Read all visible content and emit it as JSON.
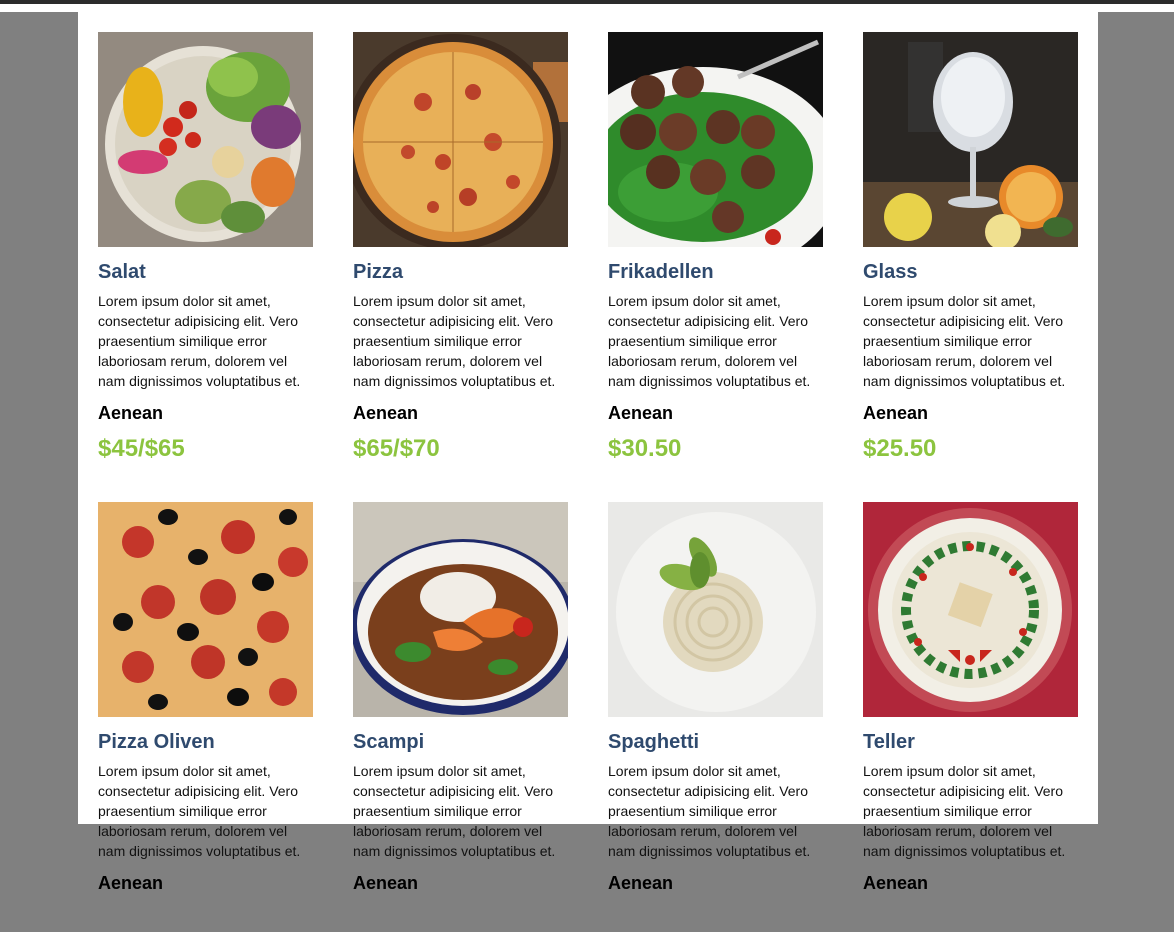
{
  "colors": {
    "title": "#2f4a6e",
    "price": "#8cc43f",
    "backdrop": "#808080",
    "panel": "#ffffff"
  },
  "items": [
    {
      "name": "Salat",
      "description": "Lorem ipsum dolor sit amet, consectetur adipisicing elit. Vero praesentium similique error laboriosam rerum, dolorem vel nam dignissimos voluptatibus et.",
      "subtitle": "Aenean",
      "price": "$45/$65",
      "image_alt": "salad bowl"
    },
    {
      "name": "Pizza",
      "description": "Lorem ipsum dolor sit amet, consectetur adipisicing elit. Vero praesentium similique error laboriosam rerum, dolorem vel nam dignissimos voluptatibus et.",
      "subtitle": "Aenean",
      "price": "$65/$70",
      "image_alt": "pizza"
    },
    {
      "name": "Frikadellen",
      "description": "Lorem ipsum dolor sit amet, consectetur adipisicing elit. Vero praesentium similique error laboriosam rerum, dolorem vel nam dignissimos voluptatibus et.",
      "subtitle": "Aenean",
      "price": "$30.50",
      "image_alt": "meatballs on greens"
    },
    {
      "name": "Glass",
      "description": "Lorem ipsum dolor sit amet, consectetur adipisicing elit. Vero praesentium similique error laboriosam rerum, dolorem vel nam dignissimos voluptatibus et.",
      "subtitle": "Aenean",
      "price": "$25.50",
      "image_alt": "gin tonic glass with citrus"
    },
    {
      "name": "Pizza Oliven",
      "description": "Lorem ipsum dolor sit amet, consectetur adipisicing elit. Vero praesentium similique error laboriosam rerum, dolorem vel nam dignissimos voluptatibus et.",
      "subtitle": "Aenean",
      "price": "",
      "image_alt": "pepperoni olive pizza"
    },
    {
      "name": "Scampi",
      "description": "Lorem ipsum dolor sit amet, consectetur adipisicing elit. Vero praesentium similique error laboriosam rerum, dolorem vel nam dignissimos voluptatibus et.",
      "subtitle": "Aenean",
      "price": "",
      "image_alt": "shrimp curry bowl"
    },
    {
      "name": "Spaghetti",
      "description": "Lorem ipsum dolor sit amet, consectetur adipisicing elit. Vero praesentium similique error laboriosam rerum, dolorem vel nam dignissimos voluptatibus et.",
      "subtitle": "Aenean",
      "price": "",
      "image_alt": "spaghetti nest with basil"
    },
    {
      "name": "Teller",
      "description": "Lorem ipsum dolor sit amet, consectetur adipisicing elit. Vero praesentium similique error laboriosam rerum, dolorem vel nam dignissimos voluptatibus et.",
      "subtitle": "Aenean",
      "price": "",
      "image_alt": "decorated plate"
    }
  ]
}
